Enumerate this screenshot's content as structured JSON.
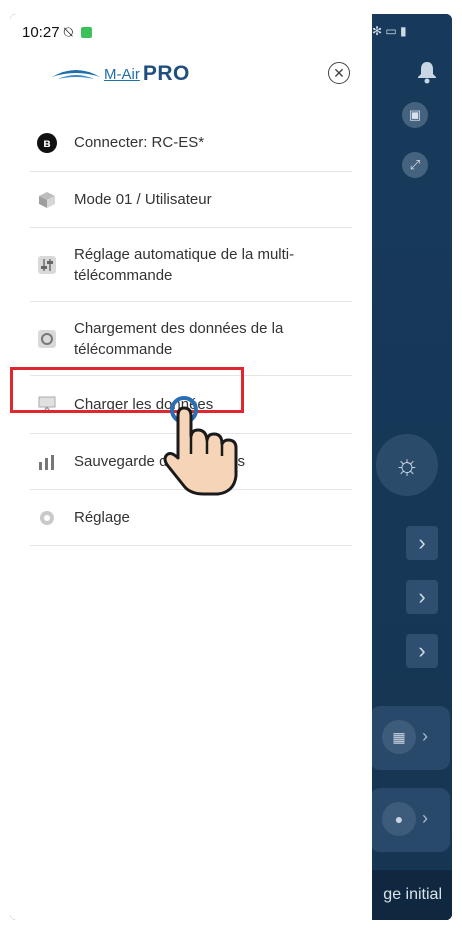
{
  "status": {
    "time": "10:27"
  },
  "header": {
    "brand_prefix": "M-Air",
    "brand_suffix": "PRO"
  },
  "menu": {
    "items": [
      {
        "label": "Connecter: RC-ES*"
      },
      {
        "label": "Mode 01 / Utilisateur"
      },
      {
        "label": "Réglage automatique de la multi-télécommande"
      },
      {
        "label": "Chargement des données de la télécommande"
      },
      {
        "label": "Charger les données"
      },
      {
        "label": "Sauvegarde des données"
      },
      {
        "label": "Réglage"
      }
    ]
  },
  "background": {
    "bottom_label": "ge initial"
  },
  "colors": {
    "highlight": "#e0262e",
    "background_app": "#173a5c",
    "brand": "#1f4f7e"
  }
}
